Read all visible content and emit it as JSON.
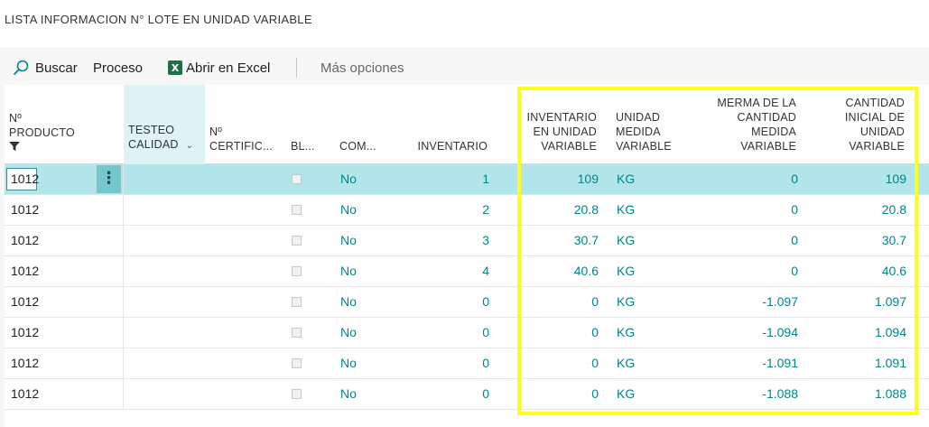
{
  "page": {
    "title": "LISTA INFORMACION N° LOTE EN UNIDAD VARIABLE"
  },
  "toolbar": {
    "search_label": "Buscar",
    "process_label": "Proceso",
    "excel_label": "Abrir en Excel",
    "excel_icon_text": "X",
    "more_label": "Más opciones"
  },
  "columns": {
    "producto_line1": "Nº",
    "producto_line2": "PRODUCTO",
    "testeo_line1": "TESTEO",
    "testeo_line2": "CALIDAD",
    "certificado_line1": "Nº",
    "certificado_line2": "CERTIFIC...",
    "bloqueado": "BL...",
    "com": "COM...",
    "inventario": "INVENTARIO",
    "inv_var_line1": "INVENTARIO",
    "inv_var_line2": "EN UNIDAD",
    "inv_var_line3": "VARIABLE",
    "unidad_line1": "UNIDAD",
    "unidad_line2": "MEDIDA",
    "unidad_line3": "VARIABLE",
    "merma_line1": "MERMA DE LA",
    "merma_line2": "CANTIDAD",
    "merma_line3": "MEDIDA",
    "merma_line4": "VARIABLE",
    "cant_line1": "CANTIDAD",
    "cant_line2": "INICIAL DE",
    "cant_line3": "UNIDAD",
    "cant_line4": "VARIABLE"
  },
  "rows": [
    {
      "producto": "1012",
      "com": "No",
      "inventario": "1",
      "inv_var": "109",
      "unidad": "KG",
      "merma": "0",
      "cantidad": "109"
    },
    {
      "producto": "1012",
      "com": "No",
      "inventario": "2",
      "inv_var": "20.8",
      "unidad": "KG",
      "merma": "0",
      "cantidad": "20.8"
    },
    {
      "producto": "1012",
      "com": "No",
      "inventario": "3",
      "inv_var": "30.7",
      "unidad": "KG",
      "merma": "0",
      "cantidad": "30.7"
    },
    {
      "producto": "1012",
      "com": "No",
      "inventario": "4",
      "inv_var": "40.6",
      "unidad": "KG",
      "merma": "0",
      "cantidad": "40.6"
    },
    {
      "producto": "1012",
      "com": "No",
      "inventario": "0",
      "inv_var": "0",
      "unidad": "KG",
      "merma": "-1.097",
      "cantidad": "1.097"
    },
    {
      "producto": "1012",
      "com": "No",
      "inventario": "0",
      "inv_var": "0",
      "unidad": "KG",
      "merma": "-1.094",
      "cantidad": "1.094"
    },
    {
      "producto": "1012",
      "com": "No",
      "inventario": "0",
      "inv_var": "0",
      "unidad": "KG",
      "merma": "-1.091",
      "cantidad": "1.091"
    },
    {
      "producto": "1012",
      "com": "No",
      "inventario": "0",
      "inv_var": "0",
      "unidad": "KG",
      "merma": "-1.088",
      "cantidad": "1.088"
    }
  ],
  "selected_row": 0,
  "icons": {
    "search": "search-icon",
    "excel": "excel-icon",
    "filter": "filter-icon",
    "chevron": "chevron-down-icon",
    "row_actions": "kebab-menu-icon"
  },
  "colors": {
    "accent": "#00858a",
    "selected_row": "#b3e6ea",
    "highlight": "#ffff1f"
  }
}
